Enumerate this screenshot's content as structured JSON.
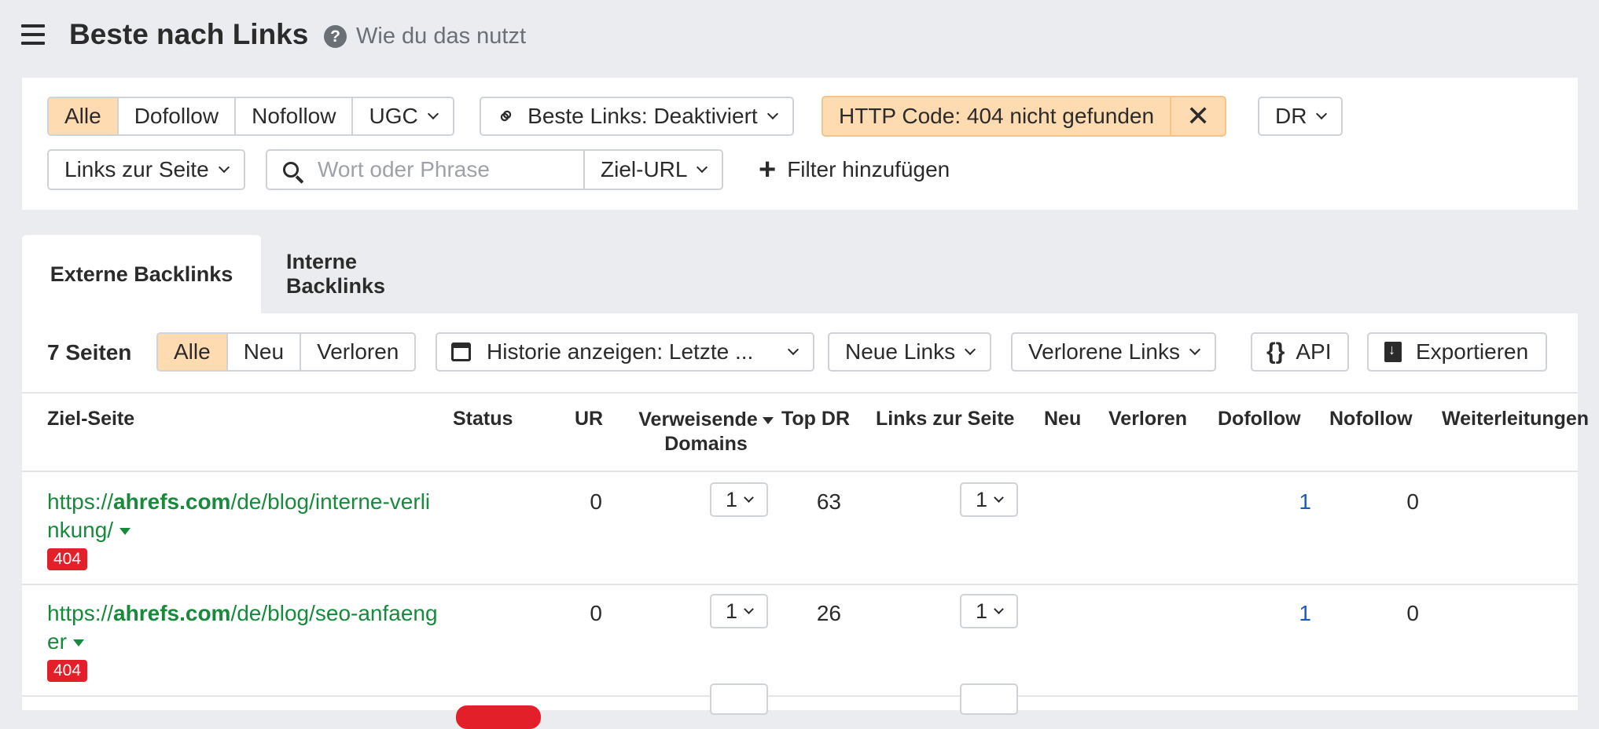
{
  "header": {
    "title": "Beste nach Links",
    "help_label": "Wie du das nutzt"
  },
  "filters": {
    "link_type": [
      "Alle",
      "Dofollow",
      "Nofollow",
      "UGC"
    ],
    "best_links": "Beste Links: Deaktiviert",
    "http_code": "HTTP Code: 404 nicht gefunden",
    "dr": "DR",
    "links_to_page": "Links zur Seite",
    "search_placeholder": "Wort oder Phrase",
    "target_url": "Ziel-URL",
    "add_filter": "Filter hinzufügen"
  },
  "tabs": [
    "Externe Backlinks",
    "Interne Backlinks"
  ],
  "toolbar": {
    "count": "7 Seiten",
    "scope": [
      "Alle",
      "Neu",
      "Verloren"
    ],
    "history": "Historie anzeigen: Letzte ...",
    "new_links": "Neue Links",
    "lost_links": "Verlorene Links",
    "api": "API",
    "export": "Exportieren"
  },
  "columns": {
    "target": "Ziel-Seite",
    "status": "Status",
    "ur": "UR",
    "ref_domains_1": "Verweisende",
    "ref_domains_2": "Domains",
    "top_dr": "Top DR",
    "links_to_page": "Links zur Seite",
    "new": "Neu",
    "lost": "Verloren",
    "dofollow": "Dofollow",
    "nofollow": "Nofollow",
    "redirects": "Weiterleitungen"
  },
  "rows": [
    {
      "url_prefix": "https://",
      "url_domain": "ahrefs.com",
      "url_path": "/de/blog/interne-verlinkung/",
      "status_code": "404",
      "ur": "0",
      "ref_domains": "1",
      "top_dr": "63",
      "links": "1",
      "dofollow": "1",
      "nofollow": "0"
    },
    {
      "url_prefix": "https://",
      "url_domain": "ahrefs.com",
      "url_path": "/de/blog/seo-anfaenger",
      "status_code": "404",
      "ur": "0",
      "ref_domains": "1",
      "top_dr": "26",
      "links": "1",
      "dofollow": "1",
      "nofollow": "0"
    }
  ],
  "colors": {
    "accent_active": "#fedbb0",
    "link_green": "#178a3c",
    "badge_red": "#e3202a",
    "link_blue": "#1a5bbf"
  }
}
